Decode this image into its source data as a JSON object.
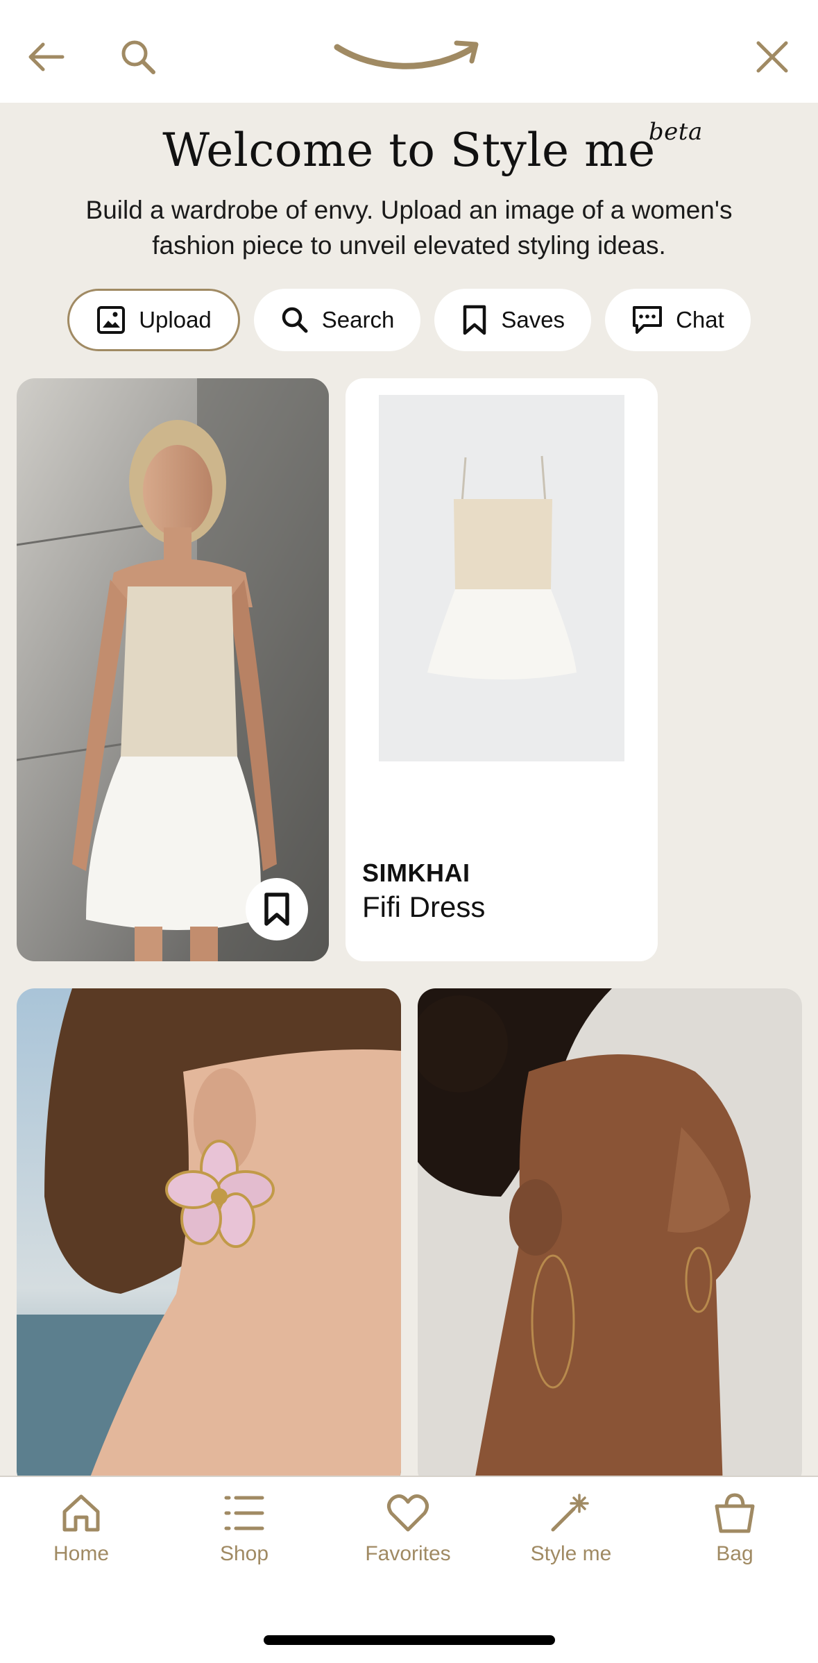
{
  "colors": {
    "accent": "#a08a63",
    "background": "#efece6",
    "surface": "#ffffff",
    "text": "#111111"
  },
  "topbar": {
    "back_icon": "arrow-left-icon",
    "search_icon": "search-icon",
    "logo_icon": "amazon-smile-logo",
    "close_icon": "close-icon"
  },
  "header": {
    "title": "Welcome to Style me",
    "badge": "beta",
    "subtitle": "Build a wardrobe of envy. Upload an image of a women's fashion piece to unveil elevated styling ideas."
  },
  "actions": [
    {
      "label": "Upload",
      "icon": "image-upload-icon",
      "active": true
    },
    {
      "label": "Search",
      "icon": "search-icon",
      "active": false
    },
    {
      "label": "Saves",
      "icon": "bookmark-icon",
      "active": false
    },
    {
      "label": "Chat",
      "icon": "chat-icon",
      "active": false
    }
  ],
  "product": {
    "brand": "SIMKHAI",
    "name": "Fifi Dress"
  },
  "nav": [
    {
      "label": "Home",
      "icon": "home-icon"
    },
    {
      "label": "Shop",
      "icon": "list-icon"
    },
    {
      "label": "Favorites",
      "icon": "heart-icon"
    },
    {
      "label": "Style me",
      "icon": "sparkle-wand-icon"
    },
    {
      "label": "Bag",
      "icon": "shopping-bag-icon"
    }
  ]
}
